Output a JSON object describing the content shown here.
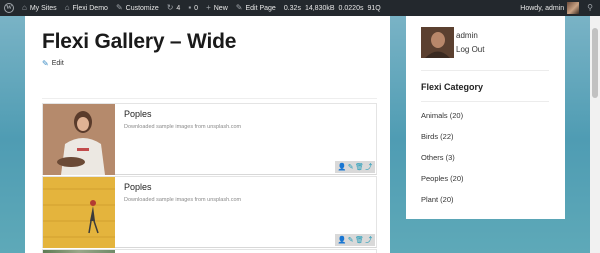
{
  "adminbar": {
    "my_sites": "My Sites",
    "site_name": "Flexi Demo",
    "customize": "Customize",
    "updates_count": "4",
    "comments_count": "0",
    "new_label": "New",
    "edit_page": "Edit Page",
    "perf_time": "0.32s",
    "perf_memory": "14,830kB",
    "perf_query_time": "0.0220s",
    "perf_queries": "91Q",
    "howdy": "Howdy, admin"
  },
  "page": {
    "title": "Flexi Gallery – Wide",
    "edit_label": "Edit"
  },
  "gallery": [
    {
      "name": "Poples",
      "desc": "Downloaded sample images from unsplash.com"
    },
    {
      "name": "Poples",
      "desc": "Downloaded sample images from unsplash.com"
    },
    {
      "name": "",
      "desc": ""
    }
  ],
  "sidebar": {
    "user_name": "admin",
    "logout": "Log Out",
    "category_title": "Flexi Category",
    "categories": [
      "Animals (20)",
      "Birds (22)",
      "Others (3)",
      "Peoples (20)",
      "Plant (20)"
    ]
  },
  "icons": {
    "wp": "wordpress-icon",
    "home": "home-icon",
    "brush": "paintbrush-icon",
    "updates": "updates-icon",
    "comments": "comments-icon",
    "plus": "plus-icon",
    "pencil": "pencil-icon",
    "search": "search-icon"
  }
}
